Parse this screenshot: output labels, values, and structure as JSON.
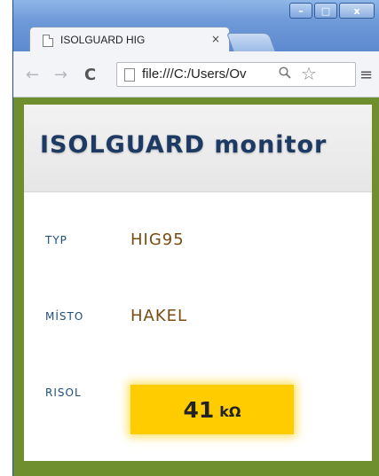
{
  "browser": {
    "tab_title": "ISOLGUARD HIG",
    "tab_close": "×",
    "url": "file:///C:/Users/Ov",
    "controls": {
      "minimize": "–",
      "maximize": "□",
      "close": "x"
    }
  },
  "page": {
    "title": "ISOLGUARD monitor",
    "rows": [
      {
        "label": "TYP",
        "value": "HIG95"
      },
      {
        "label": "MÍSTO",
        "value": "HAKEL"
      },
      {
        "label": "RISOL",
        "value": "41",
        "unit": "kΩ"
      }
    ]
  },
  "colors": {
    "frame_green": "#6f8e2d",
    "title_blue": "#1c3a63",
    "value_brown": "#7a4b12",
    "risol_yellow": "#ffcc00"
  }
}
